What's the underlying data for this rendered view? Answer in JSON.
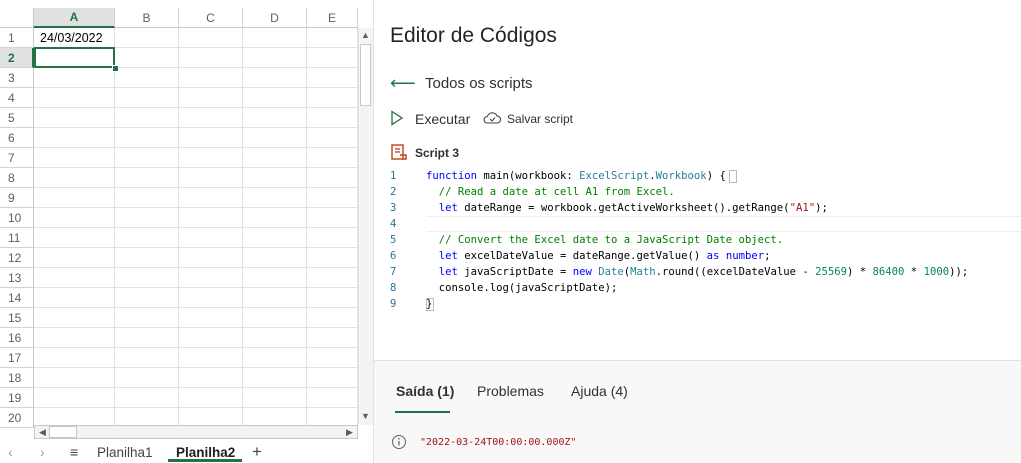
{
  "sheet": {
    "columns": [
      "A",
      "B",
      "C",
      "D",
      "E"
    ],
    "rows": [
      "1",
      "2",
      "3",
      "4",
      "5",
      "6",
      "7",
      "8",
      "9",
      "10",
      "11",
      "12",
      "13",
      "14",
      "15",
      "16",
      "17",
      "18",
      "19",
      "20"
    ],
    "cell_a1": "24/03/2022",
    "tabs": {
      "planilha1": "Planilha1",
      "planilha2": "Planilha2",
      "add": "+",
      "prev": "‹",
      "next": "›",
      "menu": "≡"
    }
  },
  "editor": {
    "title": "Editor de Códigos",
    "back_label": "Todos os scripts",
    "run_label": "Executar",
    "save_label": "Salvar script",
    "script_name": "Script 3",
    "code": [
      {
        "n": "1",
        "t": "function main(workbook: ExcelScript.Workbook) {"
      },
      {
        "n": "2",
        "t": "  // Read a date at cell A1 from Excel."
      },
      {
        "n": "3",
        "t": "  let dateRange = workbook.getActiveWorksheet().getRange(\"A1\");"
      },
      {
        "n": "4",
        "t": ""
      },
      {
        "n": "5",
        "t": "  // Convert the Excel date to a JavaScript Date object."
      },
      {
        "n": "6",
        "t": "  let excelDateValue = dateRange.getValue() as number;"
      },
      {
        "n": "7",
        "t": "  let javaScriptDate = new Date(Math.round((excelDateValue - 25569) * 86400 * 1000));"
      },
      {
        "n": "8",
        "t": "  console.log(javaScriptDate);"
      },
      {
        "n": "9",
        "t": "}"
      }
    ],
    "output_tabs": [
      "Saída (1)",
      "Problemas",
      "Ajuda (4)"
    ],
    "output_line": "\"2022-03-24T00:00:00.000Z\""
  },
  "colors": {
    "accent": "#217346",
    "keyword": "#0000ff",
    "comment": "#008000",
    "string": "#a31515",
    "type": "#267f99",
    "number": "#098658"
  }
}
